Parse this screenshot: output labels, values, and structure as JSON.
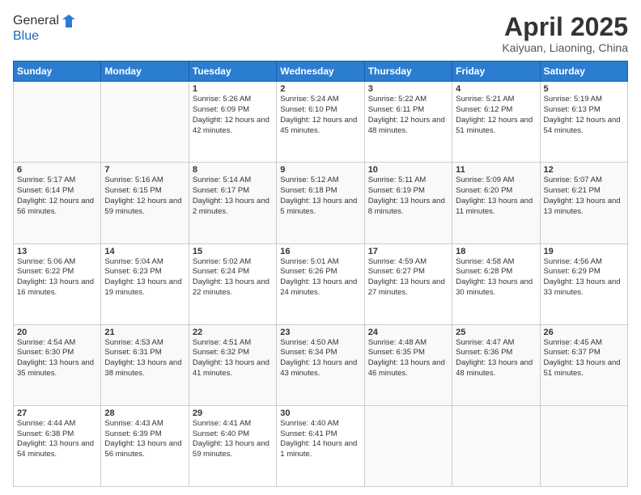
{
  "header": {
    "logo_general": "General",
    "logo_blue": "Blue",
    "title": "April 2025",
    "subtitle": "Kaiyuan, Liaoning, China"
  },
  "days_of_week": [
    "Sunday",
    "Monday",
    "Tuesday",
    "Wednesday",
    "Thursday",
    "Friday",
    "Saturday"
  ],
  "weeks": [
    [
      {
        "day": "",
        "info": ""
      },
      {
        "day": "",
        "info": ""
      },
      {
        "day": "1",
        "info": "Sunrise: 5:26 AM\nSunset: 6:09 PM\nDaylight: 12 hours and 42 minutes."
      },
      {
        "day": "2",
        "info": "Sunrise: 5:24 AM\nSunset: 6:10 PM\nDaylight: 12 hours and 45 minutes."
      },
      {
        "day": "3",
        "info": "Sunrise: 5:22 AM\nSunset: 6:11 PM\nDaylight: 12 hours and 48 minutes."
      },
      {
        "day": "4",
        "info": "Sunrise: 5:21 AM\nSunset: 6:12 PM\nDaylight: 12 hours and 51 minutes."
      },
      {
        "day": "5",
        "info": "Sunrise: 5:19 AM\nSunset: 6:13 PM\nDaylight: 12 hours and 54 minutes."
      }
    ],
    [
      {
        "day": "6",
        "info": "Sunrise: 5:17 AM\nSunset: 6:14 PM\nDaylight: 12 hours and 56 minutes."
      },
      {
        "day": "7",
        "info": "Sunrise: 5:16 AM\nSunset: 6:15 PM\nDaylight: 12 hours and 59 minutes."
      },
      {
        "day": "8",
        "info": "Sunrise: 5:14 AM\nSunset: 6:17 PM\nDaylight: 13 hours and 2 minutes."
      },
      {
        "day": "9",
        "info": "Sunrise: 5:12 AM\nSunset: 6:18 PM\nDaylight: 13 hours and 5 minutes."
      },
      {
        "day": "10",
        "info": "Sunrise: 5:11 AM\nSunset: 6:19 PM\nDaylight: 13 hours and 8 minutes."
      },
      {
        "day": "11",
        "info": "Sunrise: 5:09 AM\nSunset: 6:20 PM\nDaylight: 13 hours and 11 minutes."
      },
      {
        "day": "12",
        "info": "Sunrise: 5:07 AM\nSunset: 6:21 PM\nDaylight: 13 hours and 13 minutes."
      }
    ],
    [
      {
        "day": "13",
        "info": "Sunrise: 5:06 AM\nSunset: 6:22 PM\nDaylight: 13 hours and 16 minutes."
      },
      {
        "day": "14",
        "info": "Sunrise: 5:04 AM\nSunset: 6:23 PM\nDaylight: 13 hours and 19 minutes."
      },
      {
        "day": "15",
        "info": "Sunrise: 5:02 AM\nSunset: 6:24 PM\nDaylight: 13 hours and 22 minutes."
      },
      {
        "day": "16",
        "info": "Sunrise: 5:01 AM\nSunset: 6:26 PM\nDaylight: 13 hours and 24 minutes."
      },
      {
        "day": "17",
        "info": "Sunrise: 4:59 AM\nSunset: 6:27 PM\nDaylight: 13 hours and 27 minutes."
      },
      {
        "day": "18",
        "info": "Sunrise: 4:58 AM\nSunset: 6:28 PM\nDaylight: 13 hours and 30 minutes."
      },
      {
        "day": "19",
        "info": "Sunrise: 4:56 AM\nSunset: 6:29 PM\nDaylight: 13 hours and 33 minutes."
      }
    ],
    [
      {
        "day": "20",
        "info": "Sunrise: 4:54 AM\nSunset: 6:30 PM\nDaylight: 13 hours and 35 minutes."
      },
      {
        "day": "21",
        "info": "Sunrise: 4:53 AM\nSunset: 6:31 PM\nDaylight: 13 hours and 38 minutes."
      },
      {
        "day": "22",
        "info": "Sunrise: 4:51 AM\nSunset: 6:32 PM\nDaylight: 13 hours and 41 minutes."
      },
      {
        "day": "23",
        "info": "Sunrise: 4:50 AM\nSunset: 6:34 PM\nDaylight: 13 hours and 43 minutes."
      },
      {
        "day": "24",
        "info": "Sunrise: 4:48 AM\nSunset: 6:35 PM\nDaylight: 13 hours and 46 minutes."
      },
      {
        "day": "25",
        "info": "Sunrise: 4:47 AM\nSunset: 6:36 PM\nDaylight: 13 hours and 48 minutes."
      },
      {
        "day": "26",
        "info": "Sunrise: 4:45 AM\nSunset: 6:37 PM\nDaylight: 13 hours and 51 minutes."
      }
    ],
    [
      {
        "day": "27",
        "info": "Sunrise: 4:44 AM\nSunset: 6:38 PM\nDaylight: 13 hours and 54 minutes."
      },
      {
        "day": "28",
        "info": "Sunrise: 4:43 AM\nSunset: 6:39 PM\nDaylight: 13 hours and 56 minutes."
      },
      {
        "day": "29",
        "info": "Sunrise: 4:41 AM\nSunset: 6:40 PM\nDaylight: 13 hours and 59 minutes."
      },
      {
        "day": "30",
        "info": "Sunrise: 4:40 AM\nSunset: 6:41 PM\nDaylight: 14 hours and 1 minute."
      },
      {
        "day": "",
        "info": ""
      },
      {
        "day": "",
        "info": ""
      },
      {
        "day": "",
        "info": ""
      }
    ]
  ]
}
